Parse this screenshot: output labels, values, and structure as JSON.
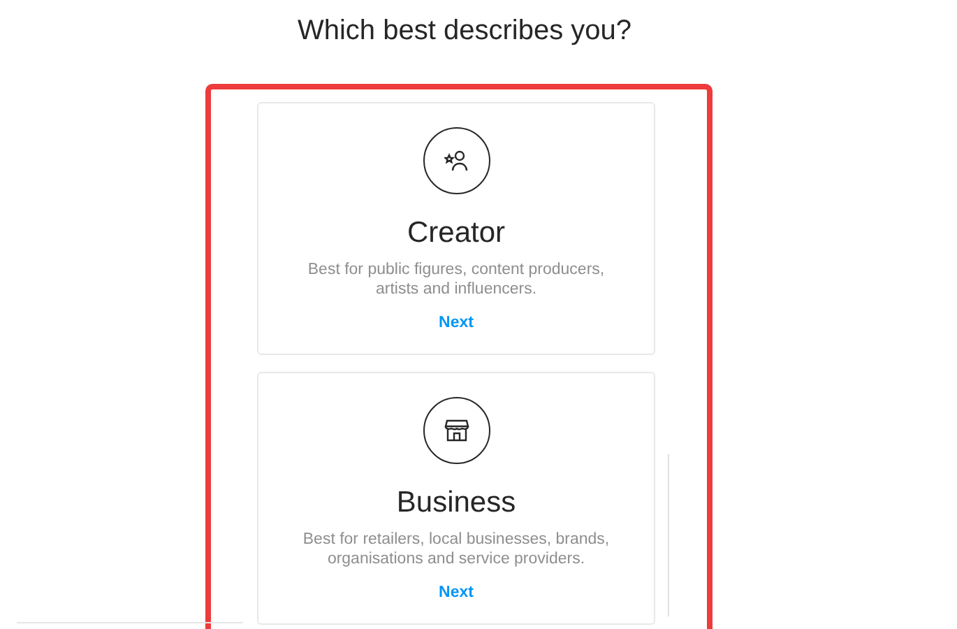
{
  "heading": "Which best describes you?",
  "options": [
    {
      "kind": "creator",
      "title": "Creator",
      "description": "Best for public figures, content producers, artists and influencers.",
      "action": "Next"
    },
    {
      "kind": "business",
      "title": "Business",
      "description": "Best for retailers, local businesses, brands, organisations and service providers.",
      "action": "Next"
    }
  ]
}
